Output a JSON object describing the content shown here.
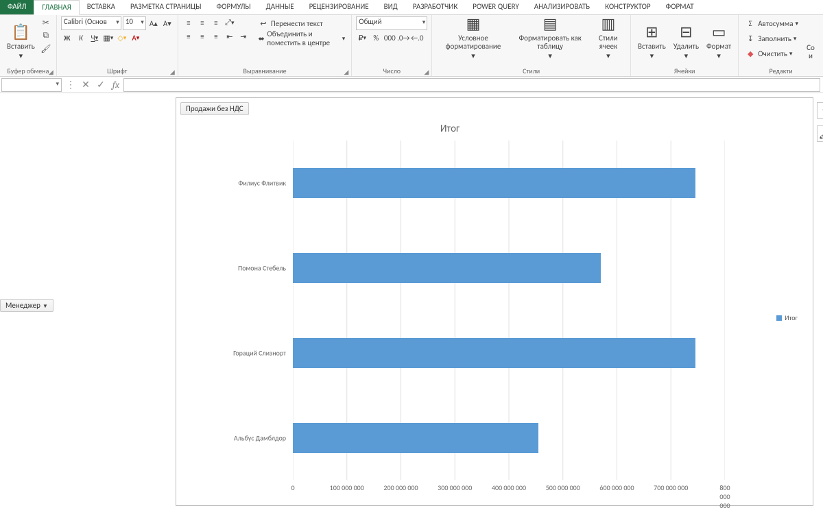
{
  "ribbon": {
    "tabs": [
      "ФАЙЛ",
      "ГЛАВНАЯ",
      "ВСТАВКА",
      "РАЗМЕТКА СТРАНИЦЫ",
      "ФОРМУЛЫ",
      "ДАННЫЕ",
      "РЕЦЕНЗИРОВАНИЕ",
      "ВИД",
      "РАЗРАБОТЧИК",
      "POWER QUERY",
      "АНАЛИЗИРОВАТЬ",
      "КОНСТРУКТОР",
      "ФОРМАТ"
    ],
    "clipboard": {
      "paste": "Вставить",
      "label": "Буфер обмена"
    },
    "font": {
      "name": "Calibri (Основ",
      "size": "10",
      "label": "Шрифт"
    },
    "align": {
      "wrap": "Перенести текст",
      "merge": "Объединить и поместить в центре",
      "label": "Выравнивание"
    },
    "number": {
      "format": "Общий",
      "label": "Число"
    },
    "styles": {
      "cond": "Условное форматирование",
      "table": "Форматировать как таблицу",
      "cell": "Стили ячеек",
      "label": "Стили"
    },
    "cells": {
      "insert": "Вставить",
      "delete": "Удалить",
      "format": "Формат",
      "label": "Ячейки"
    },
    "editing": {
      "sum": "Автосумма",
      "fill": "Заполнить",
      "clear": "Очистить",
      "sort": "Со и",
      "label": "Редакти"
    }
  },
  "formula_bar": {
    "name": "",
    "fx": "fx",
    "value": ""
  },
  "pivot": {
    "page_field": "Продажи без НДС",
    "axis_field": "Менеджер"
  },
  "chart_data": {
    "type": "bar",
    "title": "Итог",
    "orientation": "horizontal",
    "xlabel": "",
    "ylabel": "",
    "xlim": [
      0,
      800000000
    ],
    "xticks": [
      0,
      100000000,
      200000000,
      300000000,
      400000000,
      500000000,
      600000000,
      700000000,
      800000000
    ],
    "xticklabels": [
      "0",
      "100 000 000",
      "200 000 000",
      "300 000 000",
      "400 000 000",
      "500 000 000",
      "600 000 000",
      "700 000 000",
      "800 000 000"
    ],
    "categories": [
      "Филиус Флитвик",
      "Помона Стебель",
      "Гораций Слизнорт",
      "Альбус Дамблдор"
    ],
    "values": [
      745000000,
      570000000,
      745000000,
      455000000
    ],
    "legend": [
      "Итог"
    ]
  }
}
